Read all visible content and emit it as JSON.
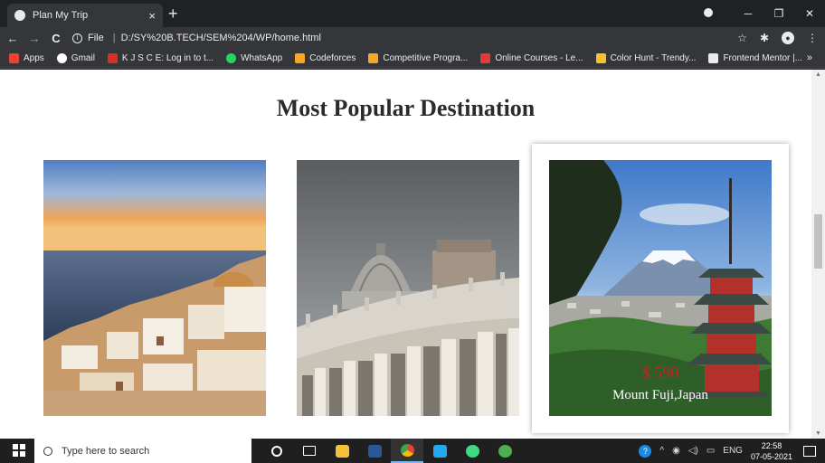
{
  "browser": {
    "tab_title": "Plan My Trip",
    "tab_close": "×",
    "new_tab": "+",
    "url_scheme": "File",
    "url": "D:/SY%20B.TECH/SEM%204/WP/home.html",
    "nav": {
      "back": "←",
      "forward": "→",
      "reload": "C"
    }
  },
  "bookmarks": [
    {
      "label": "Apps",
      "icon_color": "#ea4335"
    },
    {
      "label": "Gmail",
      "icon_color": "#ffffff"
    },
    {
      "label": "K J S C E: Log in to t...",
      "icon_color": "#d93025"
    },
    {
      "label": "WhatsApp",
      "icon_color": "#25d366"
    },
    {
      "label": "Codeforces",
      "icon_color": "#f9a825"
    },
    {
      "label": "Competitive Progra...",
      "icon_color": "#f9a825"
    },
    {
      "label": "Online Courses - Le...",
      "icon_color": "#e53935"
    },
    {
      "label": "Color Hunt - Trendy...",
      "icon_color": "#fbc02d"
    },
    {
      "label": "Frontend Mentor |...",
      "icon_color": "#e8eaed"
    }
  ],
  "bookmarks_more": "»",
  "page": {
    "heading": "Most Popular Destination",
    "cards": [
      {
        "name": "",
        "price": ""
      },
      {
        "name": "",
        "price": ""
      },
      {
        "name": "Mount Fuji,Japan",
        "price": "$ 590"
      }
    ]
  },
  "taskbar": {
    "search_placeholder": "Type here to search",
    "language": "ENG",
    "time": "22:58",
    "date": "07-05-2021"
  },
  "colors": {
    "accent_red": "#c0261f",
    "chrome_dark": "#202124",
    "chrome_mid": "#35363a"
  }
}
